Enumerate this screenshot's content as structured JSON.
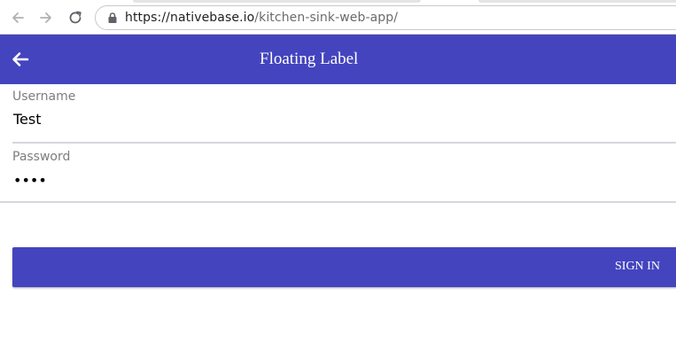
{
  "browser": {
    "url_host": "https://nativebase.io",
    "url_path": "/kitchen-sink-web-app/",
    "icons": {
      "back": "arrow-left-icon",
      "forward": "arrow-right-icon",
      "reload": "reload-icon",
      "lock": "lock-icon"
    }
  },
  "header": {
    "title": "Floating Label",
    "background": "#4444bf",
    "back_icon": "arrow-left-icon"
  },
  "form": {
    "username": {
      "label": "Username",
      "value": "Test"
    },
    "password": {
      "label": "Password",
      "value": "••••"
    },
    "submit_label": "SIGN IN",
    "accent": "#4444bf"
  }
}
